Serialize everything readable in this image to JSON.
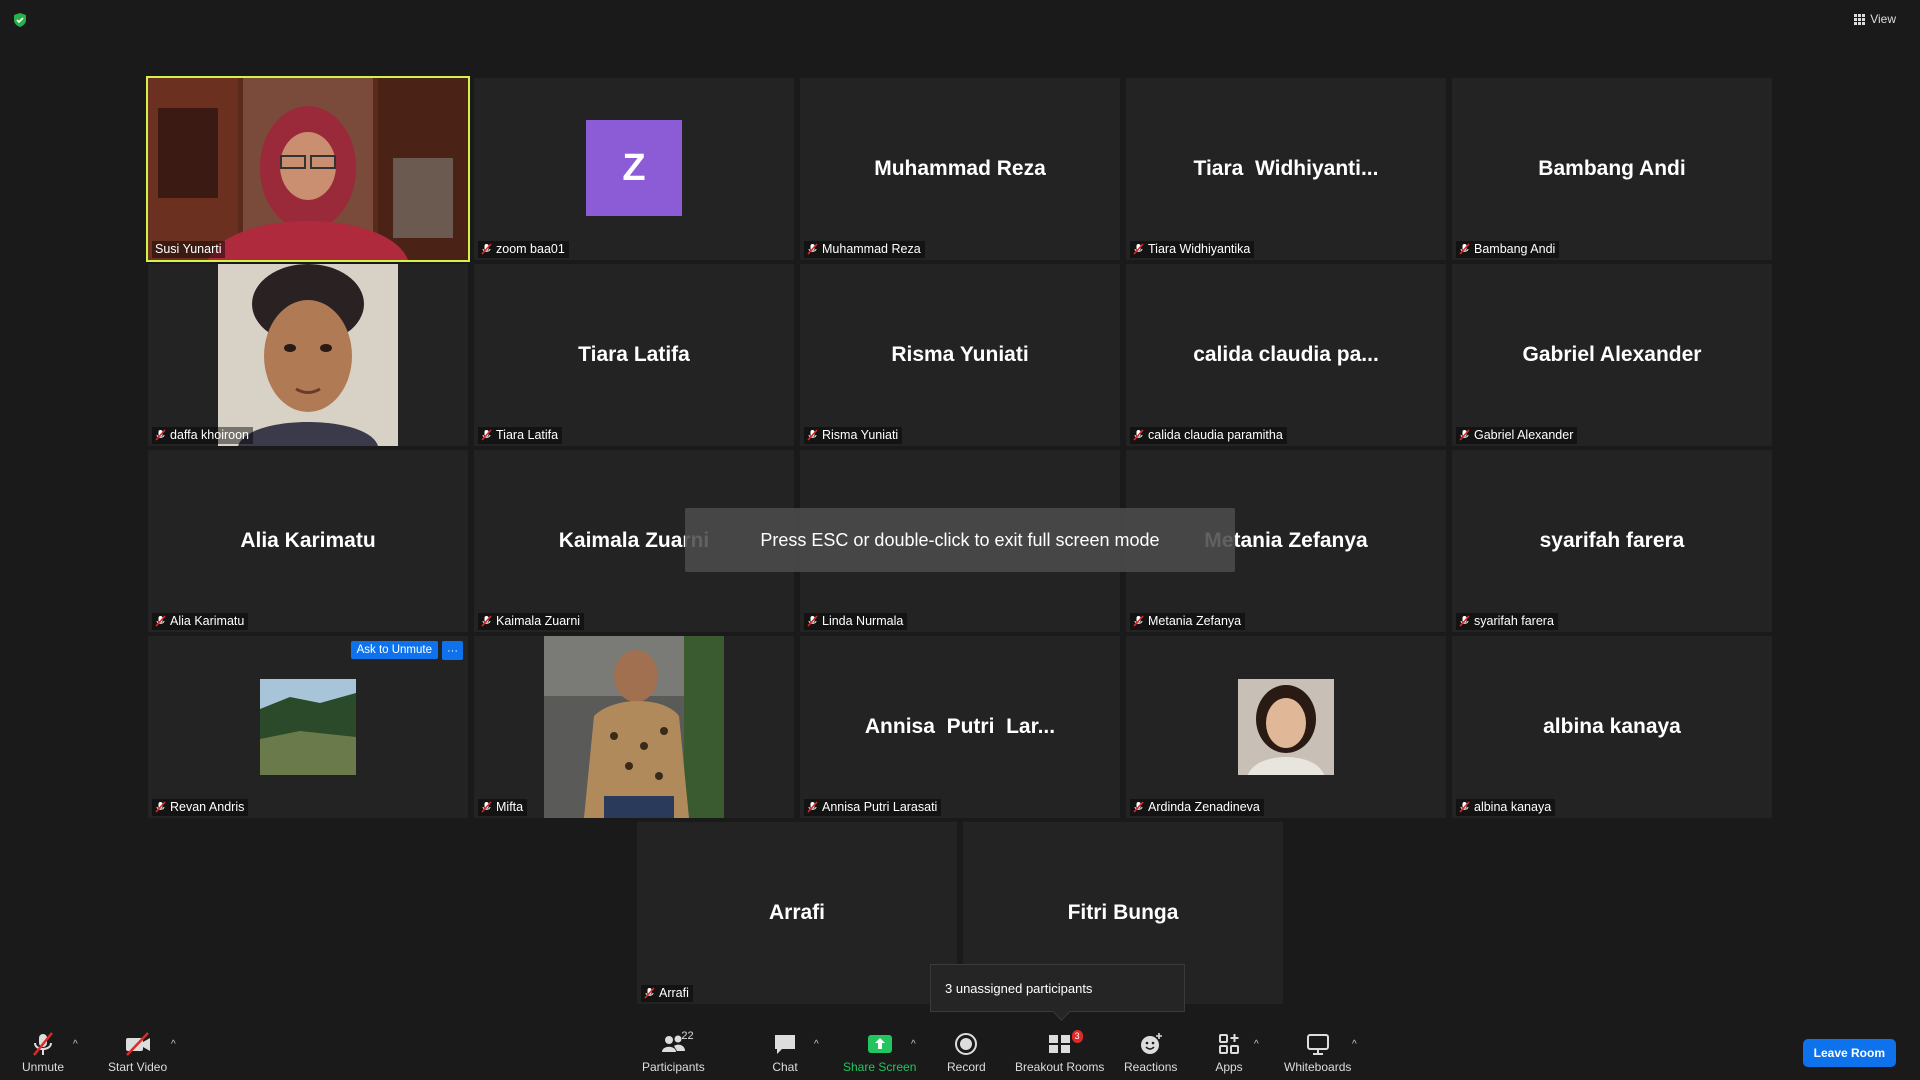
{
  "header": {
    "view_label": "View"
  },
  "tiles": {
    "susi": {
      "label": "Susi Yunarti"
    },
    "zoom": {
      "label": "zoom baa01",
      "avatar_letter": "Z"
    },
    "reza": {
      "name": "Muhammad Reza",
      "label": "Muhammad Reza"
    },
    "tiara_w": {
      "name": "Tiara  Widhiyanti...",
      "label": "Tiara Widhiyantika"
    },
    "bambang": {
      "name": "Bambang Andi",
      "label": "Bambang Andi"
    },
    "daffa": {
      "label": "daffa khoiroon"
    },
    "tiara_l": {
      "name": "Tiara Latifa",
      "label": "Tiara Latifa"
    },
    "risma": {
      "name": "Risma Yuniati",
      "label": "Risma Yuniati"
    },
    "calida": {
      "name": "calida claudia pa...",
      "label": "calida claudia paramitha"
    },
    "gabriel": {
      "name": "Gabriel Alexander",
      "label": "Gabriel Alexander"
    },
    "alia": {
      "name": "Alia Karimatu",
      "label": "Alia Karimatu"
    },
    "kaimala": {
      "name": "Kaimala Zuarni",
      "label": "Kaimala Zuarni"
    },
    "linda": {
      "label": "Linda Nurmala"
    },
    "metania": {
      "name": "Metania Zefanya",
      "label": "Metania Zefanya"
    },
    "syarifah": {
      "name": "syarifah farera",
      "label": "syarifah farera"
    },
    "revan": {
      "label": "Revan Andris",
      "ask_unmute": "Ask to Unmute",
      "more": "···"
    },
    "mifta": {
      "label": "Mifta"
    },
    "annisa": {
      "name": "Annisa  Putri  Lar...",
      "label": "Annisa Putri Larasati"
    },
    "ardinda": {
      "label": "Ardinda Zenadineva"
    },
    "albina": {
      "name": "albina kanaya",
      "label": "albina kanaya"
    },
    "arrafi": {
      "name": "Arrafi",
      "label": "Arrafi"
    },
    "fitri": {
      "name": "Fitri Bunga"
    }
  },
  "overlay": {
    "esc_message": "Press ESC or double-click to exit full screen mode"
  },
  "popup": {
    "unassigned": "3 unassigned participants"
  },
  "toolbar": {
    "unmute": "Unmute",
    "start_video": "Start Video",
    "participants": "Participants",
    "participants_count": "22",
    "chat": "Chat",
    "share_screen": "Share Screen",
    "record": "Record",
    "breakout_rooms": "Breakout Rooms",
    "breakout_badge": "3",
    "reactions": "Reactions",
    "apps": "Apps",
    "whiteboards": "Whiteboards",
    "leave_room": "Leave Room"
  },
  "colors": {
    "active_speaker_border": "#d4f24b",
    "button_blue": "#0e72ed",
    "share_green": "#22c55e",
    "avatar_purple": "#8b5cd6",
    "mute_red": "#e02828"
  }
}
